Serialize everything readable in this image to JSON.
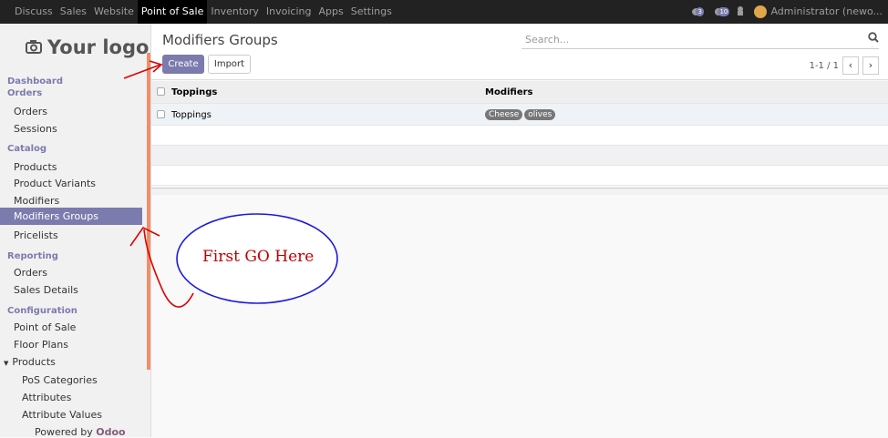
{
  "topbar": {
    "menu": [
      "Discuss",
      "Sales",
      "Website",
      "Point of Sale",
      "Inventory",
      "Invoicing",
      "Apps",
      "Settings"
    ],
    "active_index": 3,
    "badge1": "3",
    "badge2": "10",
    "user": "Administrator (newo..."
  },
  "sidebar": {
    "logo": "Your logo",
    "dashboard": "Dashboard",
    "orders_section": "Orders",
    "orders": "Orders",
    "sessions": "Sessions",
    "catalog": "Catalog",
    "products": "Products",
    "product_variants": "Product Variants",
    "modifiers": "Modifiers",
    "modifiers_groups": "Modifiers Groups",
    "pricelists": "Pricelists",
    "reporting": "Reporting",
    "rep_orders": "Orders",
    "sales_details": "Sales Details",
    "configuration": "Configuration",
    "point_of_sale": "Point of Sale",
    "floor_plans": "Floor Plans",
    "products_group": "Products",
    "pos_categories": "PoS Categories",
    "attributes": "Attributes",
    "attribute_values": "Attribute Values",
    "powered_by": "Powered by",
    "odoo": "Odoo"
  },
  "control": {
    "title": "Modifiers Groups",
    "create": "Create",
    "import": "Import",
    "search_placeholder": "Search...",
    "pager": "1-1 / 1"
  },
  "table": {
    "headers": [
      "Toppings",
      "Modifiers"
    ],
    "rows": [
      {
        "name": "Toppings",
        "tags": [
          "Cheese",
          "olives"
        ]
      }
    ]
  },
  "annotation": {
    "text": "First GO Here"
  },
  "colors": {
    "accent": "#7c7bad",
    "annotation_red": "#c00000",
    "annotation_blue": "#1a1adc"
  }
}
